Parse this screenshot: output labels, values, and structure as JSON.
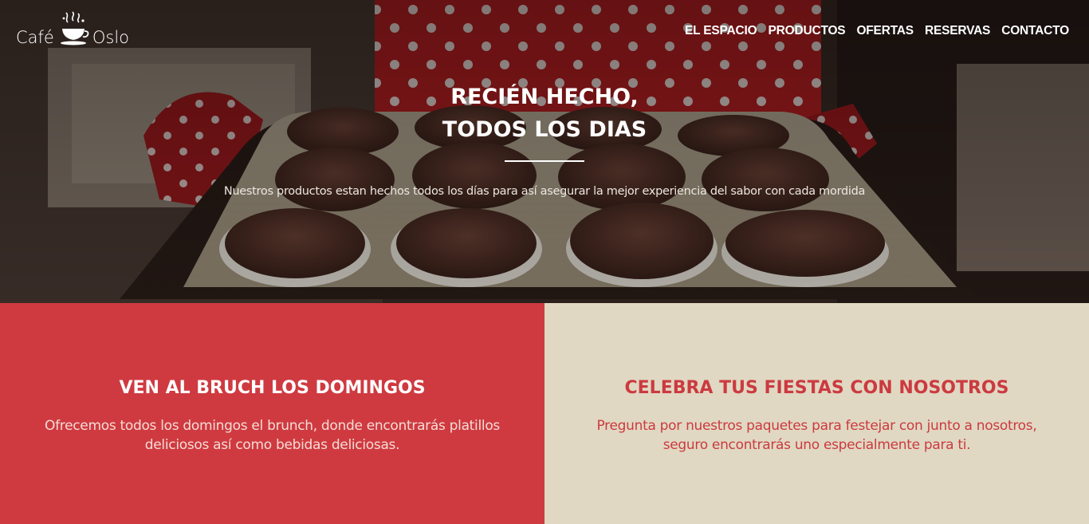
{
  "brand": {
    "word_left": "Café",
    "word_right": "Oslo",
    "icon": "coffee-cup-icon"
  },
  "nav": {
    "items": [
      {
        "label": "EL ESPACIO"
      },
      {
        "label": "PRODUCTOS"
      },
      {
        "label": "OFERTAS"
      },
      {
        "label": "RESERVAS"
      },
      {
        "label": "CONTACTO"
      }
    ]
  },
  "hero": {
    "title_line1": "RECIÉN HECHO,",
    "title_line2": "TODOS LOS DIAS",
    "subtitle": "Nuestros productos estan hechos todos los días para así asegurar la mejor experiencia del sabor con cada mordida"
  },
  "promos": [
    {
      "title": "VEN AL BRUCH LOS DOMINGOS",
      "text": "Ofrecemos todos los domingos el brunch, donde encontrarás platillos deliciosos así como bebidas deliciosas."
    },
    {
      "title": "CELEBRA TUS FIESTAS CON NOSOTROS",
      "text": "Pregunta por nuestros paquetes para festejar con junto a nosotros, seguro encontrarás uno especialmente para ti."
    }
  ],
  "colors": {
    "accent_red": "#cf3a40",
    "beige": "#e0d8c2",
    "hero_dark": "#2a1c18"
  }
}
